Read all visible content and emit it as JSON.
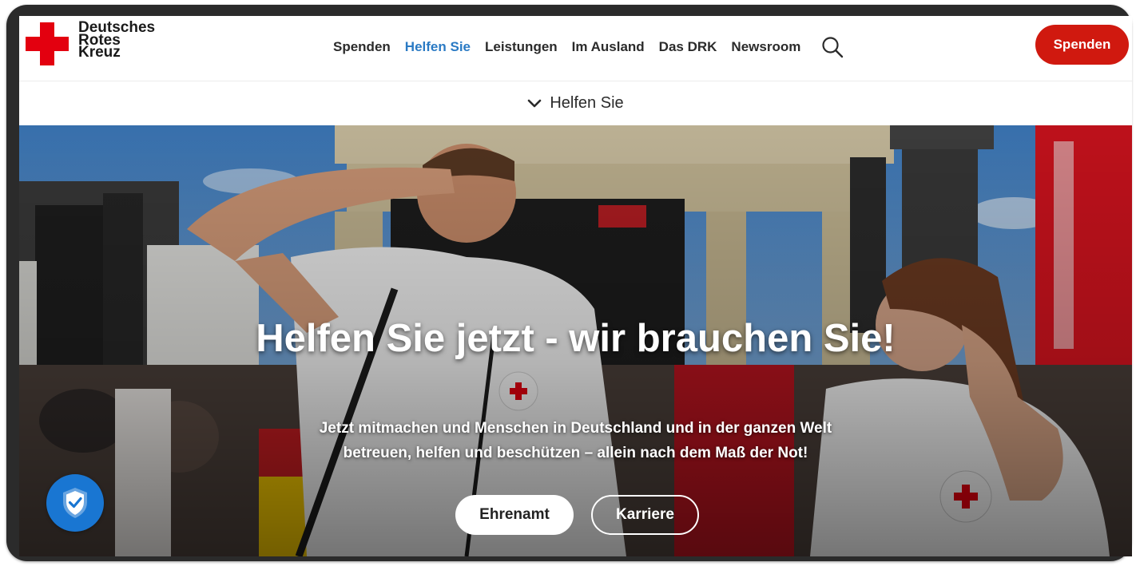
{
  "brand": {
    "line1": "Deutsches",
    "line2": "Rotes",
    "line3": "Kreuz",
    "color": "#e3000f"
  },
  "nav": {
    "items": [
      {
        "label": "Spenden",
        "active": false
      },
      {
        "label": "Helfen Sie",
        "active": true
      },
      {
        "label": "Leistungen",
        "active": false
      },
      {
        "label": "Im Ausland",
        "active": false
      },
      {
        "label": "Das DRK",
        "active": false
      },
      {
        "label": "Newsroom",
        "active": false
      }
    ],
    "search_icon": "search-icon",
    "donate_label": "Spenden",
    "active_color": "#2a7ac4"
  },
  "subnav": {
    "label": "Helfen Sie",
    "icon": "chevron-down-icon"
  },
  "hero": {
    "title": "Helfen Sie jetzt - wir brauchen Sie!",
    "text": "Jetzt mitmachen und Menschen in Deutschland und in der ganzen Welt betreuen, helfen und beschützen – allein nach dem Maß der Not!",
    "primary_button": "Ehrenamt",
    "secondary_button": "Karriere"
  },
  "widgets": {
    "privacy_badge_icon": "shield-check-icon",
    "privacy_badge_color": "#1976d2"
  },
  "colors": {
    "donate": "#d0190f",
    "text": "#2b2b2b"
  }
}
